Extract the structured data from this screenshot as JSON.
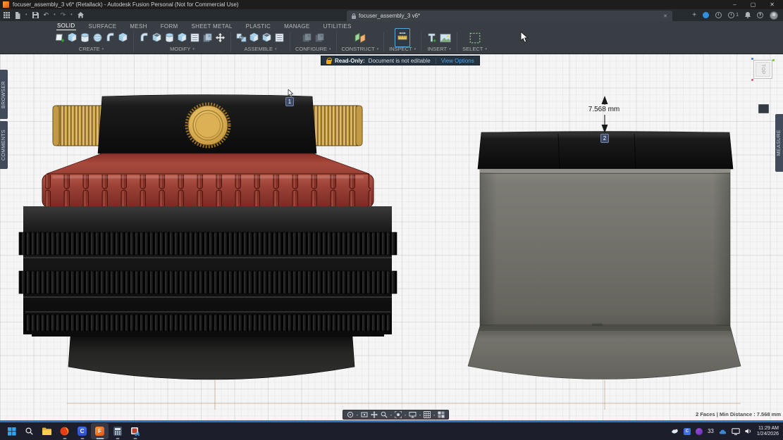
{
  "titlebar": {
    "title": "focuser_assembly_3 v6* (Retallack) - Autodesk Fusion Personal (Not for Commercial Use)",
    "minimize_glyph": "–",
    "maximize_glyph": "▢",
    "close_glyph": "✕"
  },
  "quick_access": {
    "undo_glyph": "↶",
    "redo_glyph": "↷",
    "caret_glyph": "▾"
  },
  "document_tab": {
    "label": "focuser_assembly_3 v6*",
    "close_glyph": "✕"
  },
  "header": {
    "new_tab_glyph": "+",
    "notification_count": "1",
    "help_glyph": "?"
  },
  "ribbon": {
    "caret_glyph": "▾",
    "tabs": [
      {
        "label": "SOLID",
        "active": true
      },
      {
        "label": "SURFACE"
      },
      {
        "label": "MESH"
      },
      {
        "label": "FORM"
      },
      {
        "label": "SHEET METAL"
      },
      {
        "label": "PLASTIC"
      },
      {
        "label": "MANAGE"
      },
      {
        "label": "UTILITIES"
      }
    ],
    "groups": [
      {
        "label": "CREATE"
      },
      {
        "label": "MODIFY"
      },
      {
        "label": "ASSEMBLE"
      },
      {
        "label": "CONFIGURE"
      },
      {
        "label": "CONSTRUCT"
      },
      {
        "label": "INSPECT"
      },
      {
        "label": "INSERT"
      },
      {
        "label": "SELECT"
      }
    ]
  },
  "banner": {
    "title": "Read-Only:",
    "message": "Document is not editable",
    "action": "View Options"
  },
  "panels": {
    "browser": "BROWSER",
    "comments": "COMMENTS",
    "measure": "MEASURE"
  },
  "viewcube": {
    "face": "TOP"
  },
  "measurement": {
    "dimension": "7.568 mm",
    "marker_1": "1",
    "marker_2": "2"
  },
  "status_bar": {
    "selection_info": "2 Faces | Min Distance : 7.568 mm"
  },
  "taskbar": {
    "c_app_label": "C",
    "fusion_label": "F",
    "temperature": "33",
    "time": "11:29 AM",
    "date": "1/24/2026"
  },
  "colors": {
    "accent_blue": "#2f6fce",
    "banner_link": "#4fa3e3",
    "ribbon_bg": "#383e43",
    "canvas_bg": "#f5f5f6",
    "model_red": "#9c3b32",
    "model_gold": "#d2a24a",
    "model_gray": "#71716c",
    "model_black": "#0f0f0f"
  }
}
